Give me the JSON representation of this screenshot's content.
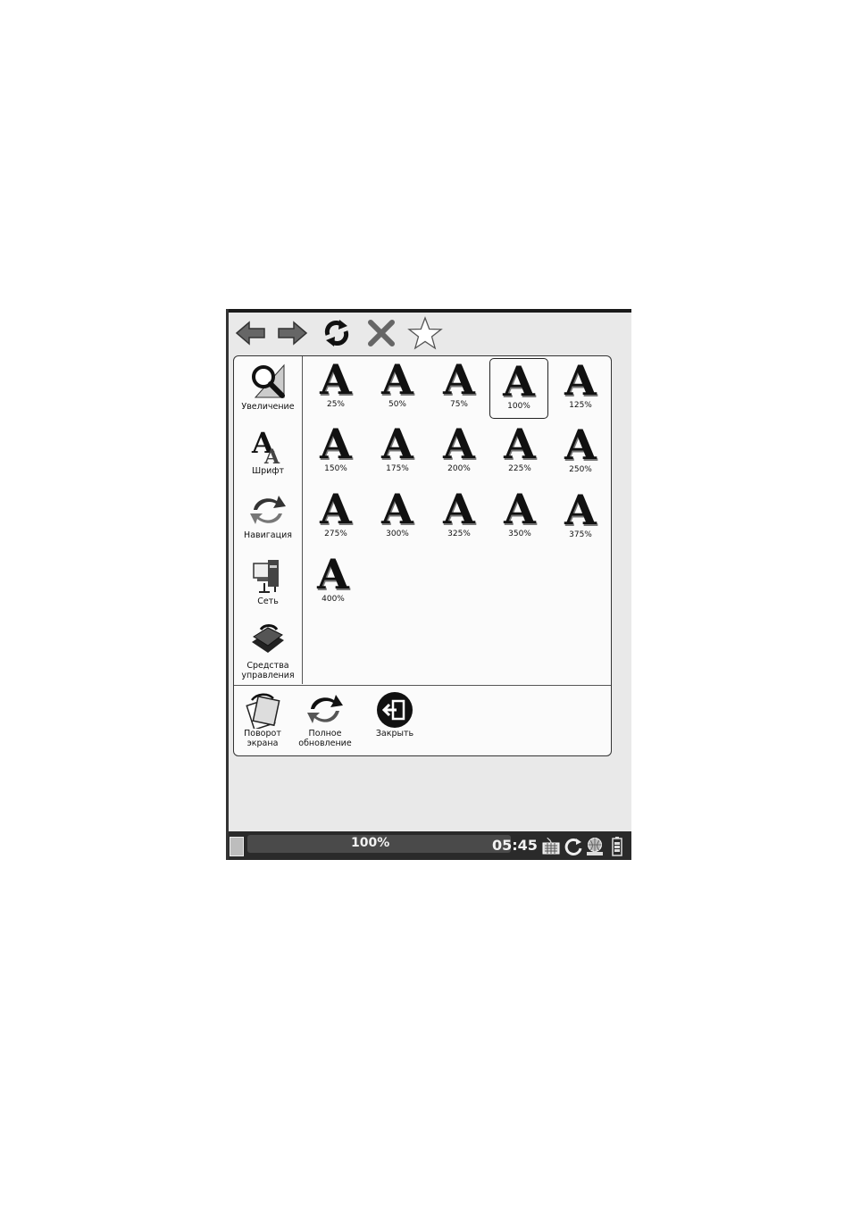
{
  "toolbar": {
    "icons": [
      "back-icon",
      "forward-icon",
      "refresh-icon",
      "close-icon",
      "star-icon"
    ]
  },
  "sidebar": {
    "items": [
      {
        "label": "Увеличение",
        "icon": "magnifier-icon"
      },
      {
        "label": "Шрифт",
        "icon": "font-icon"
      },
      {
        "label": "Навигация",
        "icon": "navigation-icon"
      },
      {
        "label": "Сеть",
        "icon": "network-icon"
      },
      {
        "label": "Средства\nуправления",
        "icon": "tools-icon"
      }
    ]
  },
  "zoom": {
    "glyph": "A",
    "selected": "100%",
    "options": [
      "25%",
      "50%",
      "75%",
      "100%",
      "125%",
      "150%",
      "175%",
      "200%",
      "225%",
      "250%",
      "275%",
      "300%",
      "325%",
      "350%",
      "375%",
      "400%"
    ]
  },
  "bottom": {
    "items": [
      {
        "label": "Поворот\nэкрана",
        "icon": "rotate-screen-icon"
      },
      {
        "label": "Полное\nобновление",
        "icon": "full-refresh-icon"
      },
      {
        "label": "Закрыть",
        "icon": "exit-icon"
      }
    ]
  },
  "status": {
    "zoom": "100%",
    "time": "05:45",
    "icons": [
      "document-icon",
      "keyboard-icon",
      "sync-icon",
      "wifi-globe-icon",
      "battery-icon"
    ]
  }
}
